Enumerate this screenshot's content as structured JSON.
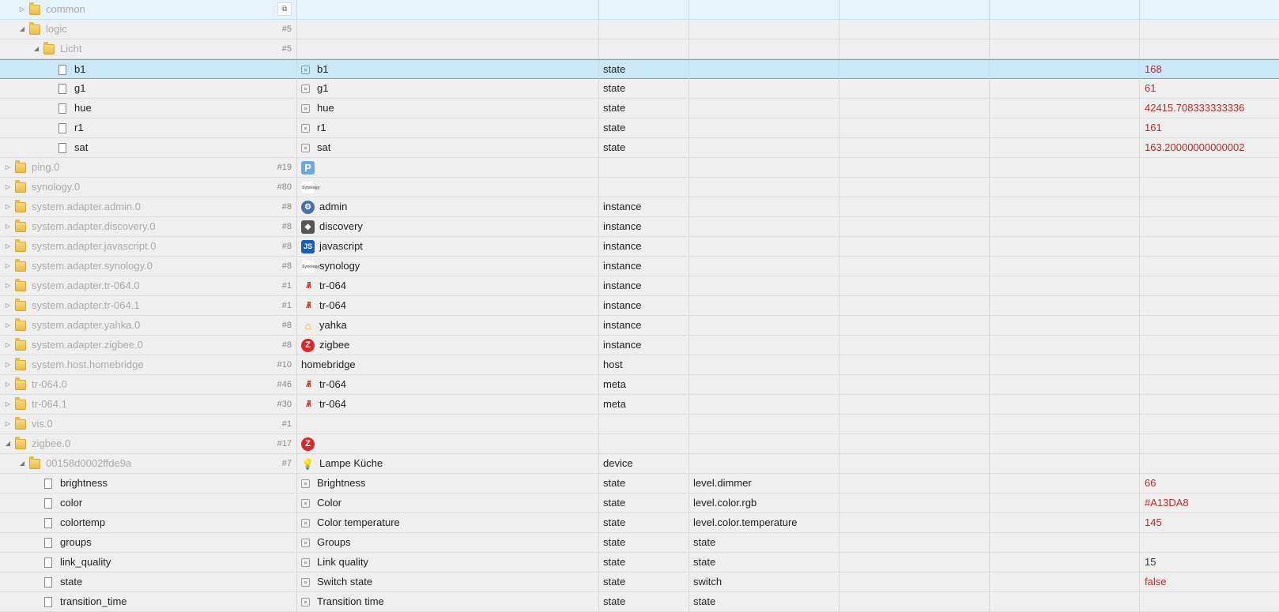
{
  "rows": [
    {
      "id": "common",
      "depth": 1,
      "kind": "folder",
      "toggle": "closed",
      "name": "common",
      "copy": true,
      "hl": "light"
    },
    {
      "id": "logic",
      "depth": 1,
      "kind": "folder",
      "toggle": "open",
      "name": "logic",
      "count": "#5"
    },
    {
      "id": "licht",
      "depth": 2,
      "kind": "folder",
      "toggle": "open",
      "name": "Licht",
      "count": "#5"
    },
    {
      "id": "b1",
      "depth": 3,
      "kind": "leaf",
      "name": "b1",
      "icon": "state",
      "label": "b1",
      "type": "state",
      "value": "168",
      "selected": true
    },
    {
      "id": "g1",
      "depth": 3,
      "kind": "leaf",
      "name": "g1",
      "icon": "state",
      "label": "g1",
      "type": "state",
      "value": "61"
    },
    {
      "id": "hue",
      "depth": 3,
      "kind": "leaf",
      "name": "hue",
      "icon": "state",
      "label": "hue",
      "type": "state",
      "value": "42415.708333333336"
    },
    {
      "id": "r1",
      "depth": 3,
      "kind": "leaf",
      "name": "r1",
      "icon": "state",
      "label": "r1",
      "type": "state",
      "value": "161"
    },
    {
      "id": "sat",
      "depth": 3,
      "kind": "leaf",
      "name": "sat",
      "icon": "state",
      "label": "sat",
      "type": "state",
      "value": "163.20000000000002"
    },
    {
      "id": "ping0",
      "depth": 0,
      "kind": "folder",
      "toggle": "closed",
      "name": "ping.0",
      "count": "#19",
      "icon": "ping"
    },
    {
      "id": "synology0",
      "depth": 0,
      "kind": "folder",
      "toggle": "closed",
      "name": "synology.0",
      "count": "#80",
      "icon": "syno"
    },
    {
      "id": "sa-admin",
      "depth": 0,
      "kind": "folder",
      "toggle": "closed",
      "name": "system.adapter.admin.0",
      "count": "#8",
      "icon": "admin",
      "label": "admin",
      "type": "instance"
    },
    {
      "id": "sa-discovery",
      "depth": 0,
      "kind": "folder",
      "toggle": "closed",
      "name": "system.adapter.discovery.0",
      "count": "#8",
      "icon": "disc",
      "label": "discovery",
      "type": "instance"
    },
    {
      "id": "sa-javascript",
      "depth": 0,
      "kind": "folder",
      "toggle": "closed",
      "name": "system.adapter.javascript.0",
      "count": "#8",
      "icon": "js",
      "label": "javascript",
      "type": "instance"
    },
    {
      "id": "sa-synology",
      "depth": 0,
      "kind": "folder",
      "toggle": "closed",
      "name": "system.adapter.synology.0",
      "count": "#8",
      "icon": "syno",
      "label": "synology",
      "type": "instance"
    },
    {
      "id": "sa-tr0",
      "depth": 0,
      "kind": "folder",
      "toggle": "closed",
      "name": "system.adapter.tr-064.0",
      "count": "#1",
      "icon": "tr",
      "label": "tr-064",
      "type": "instance"
    },
    {
      "id": "sa-tr1",
      "depth": 0,
      "kind": "folder",
      "toggle": "closed",
      "name": "system.adapter.tr-064.1",
      "count": "#1",
      "icon": "tr",
      "label": "tr-064",
      "type": "instance"
    },
    {
      "id": "sa-yahka",
      "depth": 0,
      "kind": "folder",
      "toggle": "closed",
      "name": "system.adapter.yahka.0",
      "count": "#8",
      "icon": "yahka",
      "label": "yahka",
      "type": "instance"
    },
    {
      "id": "sa-zigbee",
      "depth": 0,
      "kind": "folder",
      "toggle": "closed",
      "name": "system.adapter.zigbee.0",
      "count": "#8",
      "icon": "zig",
      "label": "zigbee",
      "type": "instance"
    },
    {
      "id": "sh-homebridge",
      "depth": 0,
      "kind": "folder",
      "toggle": "closed",
      "name": "system.host.homebridge",
      "count": "#10",
      "label": "homebridge",
      "type": "host"
    },
    {
      "id": "tr0",
      "depth": 0,
      "kind": "folder",
      "toggle": "closed",
      "name": "tr-064.0",
      "count": "#46",
      "icon": "tr",
      "label": "tr-064",
      "type": "meta"
    },
    {
      "id": "tr1",
      "depth": 0,
      "kind": "folder",
      "toggle": "closed",
      "name": "tr-064.1",
      "count": "#30",
      "icon": "tr",
      "label": "tr-064",
      "type": "meta"
    },
    {
      "id": "vis0",
      "depth": 0,
      "kind": "folder",
      "toggle": "closed",
      "name": "vis.0",
      "count": "#1"
    },
    {
      "id": "zigbee0",
      "depth": 0,
      "kind": "folder",
      "toggle": "open",
      "name": "zigbee.0",
      "count": "#17",
      "icon": "zig"
    },
    {
      "id": "device",
      "depth": 1,
      "kind": "folder",
      "toggle": "open",
      "name": "00158d0002ffde9a",
      "count": "#7",
      "icon": "lamp",
      "label": "Lampe Küche",
      "type": "device"
    },
    {
      "id": "brightness",
      "depth": 2,
      "kind": "leaf",
      "name": "brightness",
      "icon": "state",
      "label": "Brightness",
      "type": "state",
      "role": "level.dimmer",
      "value": "66"
    },
    {
      "id": "color",
      "depth": 2,
      "kind": "leaf",
      "name": "color",
      "icon": "state",
      "label": "Color",
      "type": "state",
      "role": "level.color.rgb",
      "value": "#A13DA8"
    },
    {
      "id": "colortemp",
      "depth": 2,
      "kind": "leaf",
      "name": "colortemp",
      "icon": "state",
      "label": "Color temperature",
      "type": "state",
      "role": "level.color.temperature",
      "value": "145"
    },
    {
      "id": "groups",
      "depth": 2,
      "kind": "leaf",
      "name": "groups",
      "icon": "state",
      "label": "Groups",
      "type": "state",
      "role": "state"
    },
    {
      "id": "link_quality",
      "depth": 2,
      "kind": "leaf",
      "name": "link_quality",
      "icon": "state",
      "label": "Link quality",
      "type": "state",
      "role": "state",
      "value": "15",
      "plain": true
    },
    {
      "id": "state",
      "depth": 2,
      "kind": "leaf",
      "name": "state",
      "icon": "state",
      "label": "Switch state",
      "type": "state",
      "role": "switch",
      "value": "false"
    },
    {
      "id": "transition_time",
      "depth": 2,
      "kind": "leaf",
      "name": "transition_time",
      "icon": "state",
      "label": "Transition time",
      "type": "state",
      "role": "state"
    }
  ],
  "icon_glyphs": {
    "ping": "P",
    "syno": "Synology",
    "admin": "⚙",
    "disc": "◆",
    "js": "JS",
    "tr": "/\\/\\",
    "yahka": "⌂",
    "zig": "Z",
    "lamp": "💡"
  }
}
